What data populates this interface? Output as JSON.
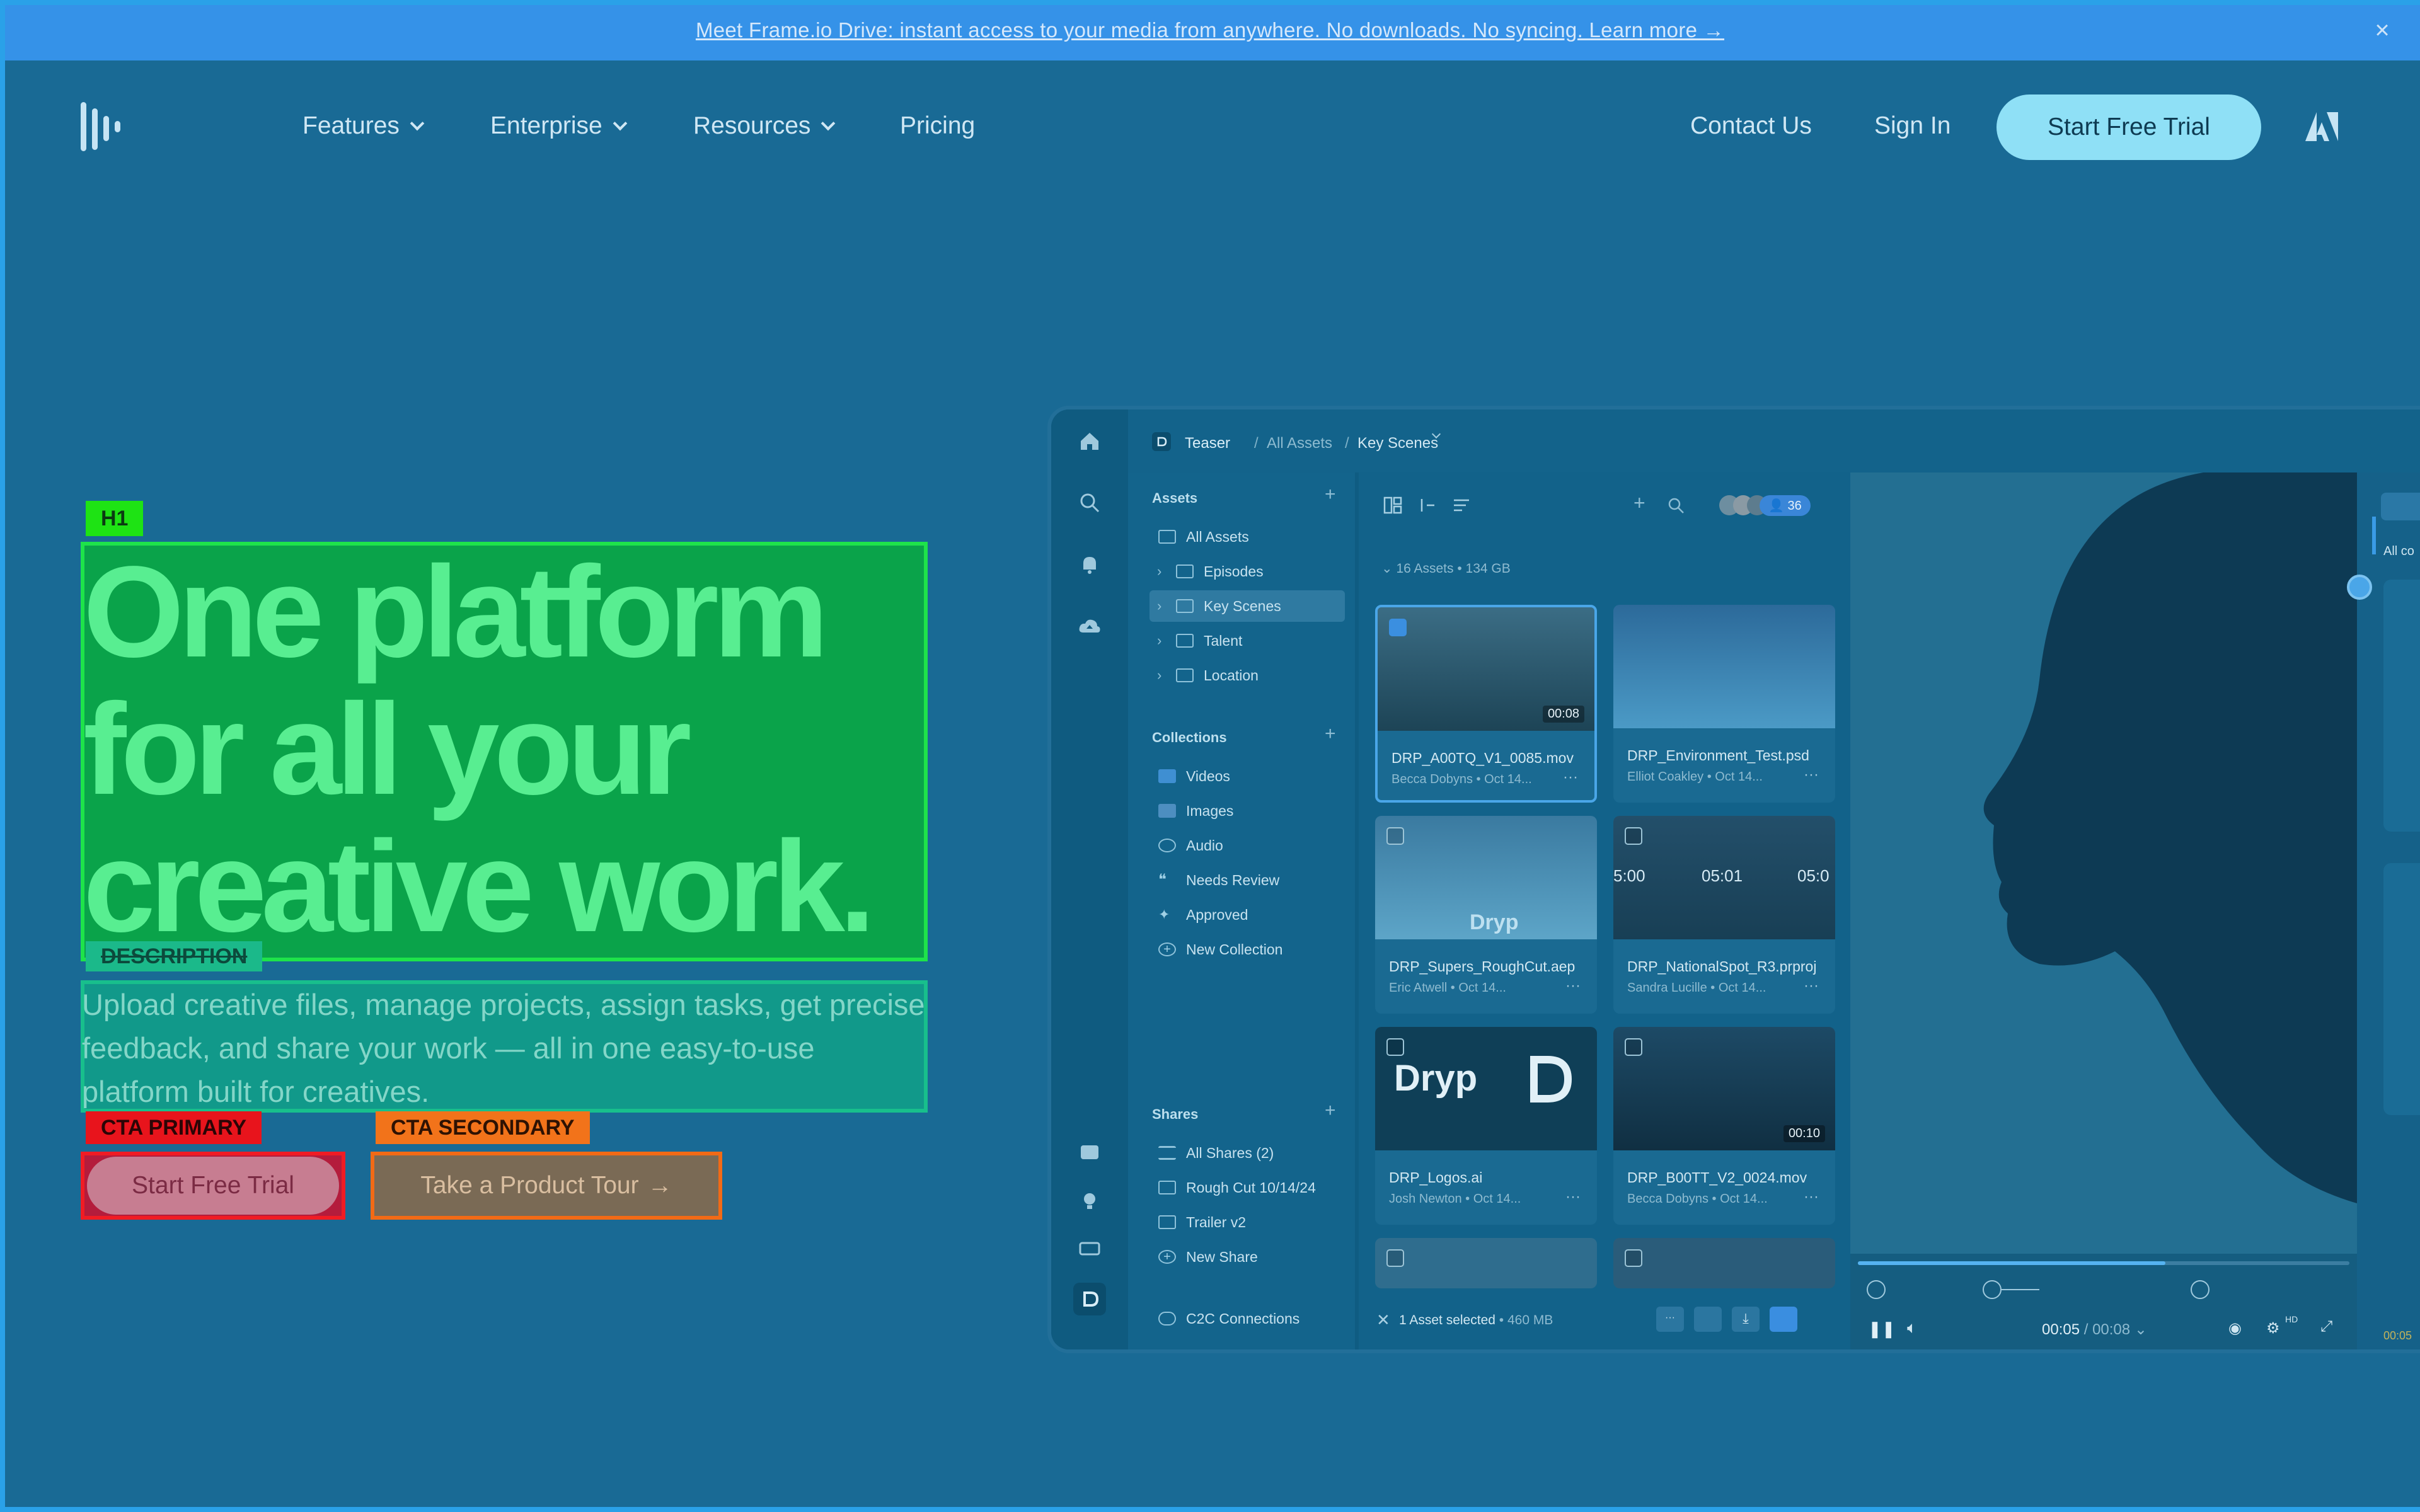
{
  "announcement": {
    "text": "Meet Frame.io Drive: instant access to your media from anywhere. No downloads. No syncing. Learn more →",
    "close": "×"
  },
  "nav": {
    "features": "Features",
    "enterprise": "Enterprise",
    "resources": "Resources",
    "pricing": "Pricing",
    "contact": "Contact Us",
    "signin": "Sign In",
    "cta": "Start Free Trial"
  },
  "hero": {
    "tag_h1": "H1",
    "title_lines": [
      "One platform",
      "for all your",
      "creative work."
    ],
    "tag_description": "DESCRIPTION",
    "description": "Upload creative files, manage projects, assign tasks, get precise feedback, and share your work — all in one easy-to-use platform built for creatives.",
    "tag_cta_primary": "CTA PRIMARY",
    "cta_primary": "Start Free Trial",
    "tag_cta_secondary": "CTA SECONDARY",
    "cta_secondary": "Take a Product Tour",
    "cta_secondary_arrow": "→"
  },
  "app": {
    "breadcrumb": {
      "project": "Teaser",
      "all_assets": "All Assets",
      "current": "Key Scenes"
    },
    "sidebar": {
      "assets_heading": "Assets",
      "assets": [
        {
          "label": "All Assets"
        },
        {
          "label": "Episodes"
        },
        {
          "label": "Key Scenes"
        },
        {
          "label": "Talent"
        },
        {
          "label": "Location"
        }
      ],
      "collections_heading": "Collections",
      "collections": [
        {
          "label": "Videos"
        },
        {
          "label": "Images"
        },
        {
          "label": "Audio"
        },
        {
          "label": "Needs Review"
        },
        {
          "label": "Approved"
        },
        {
          "label": "New Collection"
        }
      ],
      "shares_heading": "Shares",
      "shares": [
        {
          "label": "All Shares (2)"
        },
        {
          "label": "Rough Cut 10/14/24"
        },
        {
          "label": "Trailer v2"
        },
        {
          "label": "New Share"
        }
      ],
      "c2c": "C2C Connections"
    },
    "grid": {
      "summary": "16 Assets",
      "size": "134 GB",
      "member_count": "36",
      "tiles": [
        {
          "name": "DRP_A00TQ_V1_0085.mov",
          "author": "Becca Dobyns",
          "date": "Oct 14...",
          "duration": "00:08"
        },
        {
          "name": "DRP_Environment_Test.psd",
          "author": "Elliot Coakley",
          "date": "Oct 14..."
        },
        {
          "name": "DRP_Supers_RoughCut.aep",
          "author": "Eric Atwell",
          "date": "Oct 14..."
        },
        {
          "name": "DRP_NationalSpot_R3.prproj",
          "author": "Sandra Lucille",
          "date": "Oct 14..."
        },
        {
          "name": "DRP_Logos.ai",
          "author": "Josh Newton",
          "date": "Oct 14..."
        },
        {
          "name": "DRP_B00TT_V2_0024.mov",
          "author": "Becca Dobyns",
          "date": "Oct 14...",
          "duration": "00:10"
        }
      ],
      "timecodes": [
        "5:00",
        "05:01",
        "05:0"
      ],
      "logo_word": "Dryp",
      "selection": "1 Asset selected",
      "selection_size": "460 MB"
    },
    "player": {
      "current": "00:05",
      "total": "/ 00:08",
      "quality": "HD"
    },
    "right_panel": {
      "label": "All co",
      "time": "00:05"
    }
  }
}
